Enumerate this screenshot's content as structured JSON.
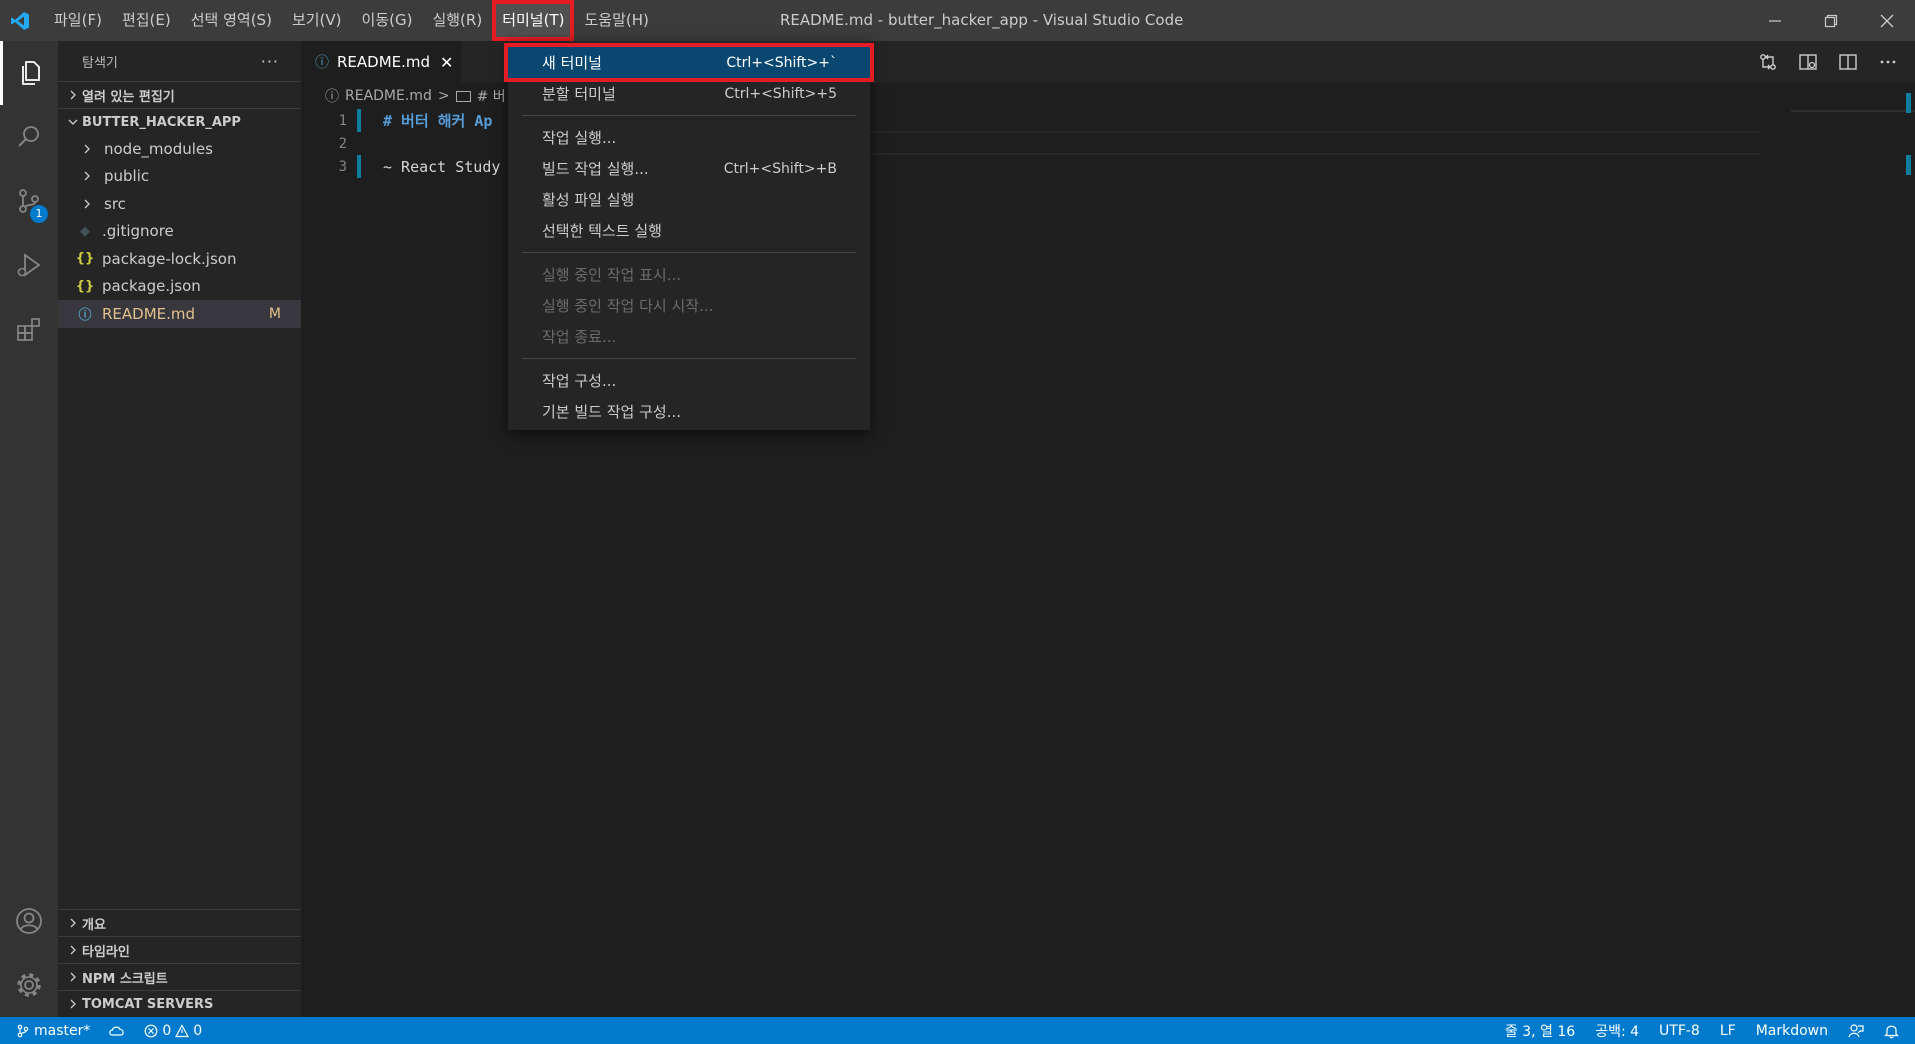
{
  "window": {
    "title": "README.md - butter_hacker_app - Visual Studio Code"
  },
  "menubar": {
    "items": [
      "파일(F)",
      "편집(E)",
      "선택 영역(S)",
      "보기(V)",
      "이동(G)",
      "실행(R)",
      "터미널(T)",
      "도움말(H)"
    ],
    "active_index": 6
  },
  "activitybar": {
    "scm_badge": "1"
  },
  "sidebar": {
    "title": "탐색기",
    "more": "···",
    "open_editors": "열려 있는 편집기",
    "project": "BUTTER_HACKER_APP",
    "tree": [
      {
        "label": "node_modules",
        "kind": "folder"
      },
      {
        "label": "public",
        "kind": "folder"
      },
      {
        "label": "src",
        "kind": "folder"
      },
      {
        "label": ".gitignore",
        "kind": "git",
        "icon": "◆"
      },
      {
        "label": "package-lock.json",
        "kind": "json",
        "icon": "{}"
      },
      {
        "label": "package.json",
        "kind": "json",
        "icon": "{}"
      },
      {
        "label": "README.md",
        "kind": "md",
        "icon": "ⓘ",
        "badge": "M"
      }
    ],
    "bottom_sections": [
      "개요",
      "타임라인",
      "NPM 스크립트",
      "TOMCAT SERVERS"
    ]
  },
  "tab": {
    "label": "README.md",
    "icon": "ⓘ",
    "close": "✕"
  },
  "breadcrumbs": {
    "file": "README.md",
    "separator": ">",
    "symbol": "# 버"
  },
  "editor": {
    "lines": [
      {
        "num": "1",
        "text": "# 버터 해커 Ap"
      },
      {
        "num": "2",
        "text": ""
      },
      {
        "num": "3",
        "text": "~ React Study"
      }
    ]
  },
  "terminal_menu": {
    "groups": [
      [
        {
          "label": "새 터미널",
          "shortcut": "Ctrl+<Shift>+`",
          "highlighted": true
        },
        {
          "label": "분할 터미널",
          "shortcut": "Ctrl+<Shift>+5"
        }
      ],
      [
        {
          "label": "작업 실행...",
          "shortcut": ""
        },
        {
          "label": "빌드 작업 실행...",
          "shortcut": "Ctrl+<Shift>+B"
        },
        {
          "label": "활성 파일 실행",
          "shortcut": ""
        },
        {
          "label": "선택한 텍스트 실행",
          "shortcut": ""
        }
      ],
      [
        {
          "label": "실행 중인 작업 표시...",
          "shortcut": "",
          "disabled": true
        },
        {
          "label": "실행 중인 작업 다시 시작...",
          "shortcut": "",
          "disabled": true
        },
        {
          "label": "작업 종료...",
          "shortcut": "",
          "disabled": true
        }
      ],
      [
        {
          "label": "작업 구성...",
          "shortcut": ""
        },
        {
          "label": "기본 빌드 작업 구성...",
          "shortcut": ""
        }
      ]
    ]
  },
  "statusbar": {
    "branch": "master*",
    "errors": "0",
    "warnings": "0",
    "position": "줄 3, 열 16",
    "indent": "공백: 4",
    "encoding": "UTF-8",
    "eol": "LF",
    "language": "Markdown"
  },
  "colors": {
    "accent": "#007acc",
    "highlight_outline": "#e51c23",
    "menu_selection": "#094771",
    "modified": "#e2c08d"
  }
}
